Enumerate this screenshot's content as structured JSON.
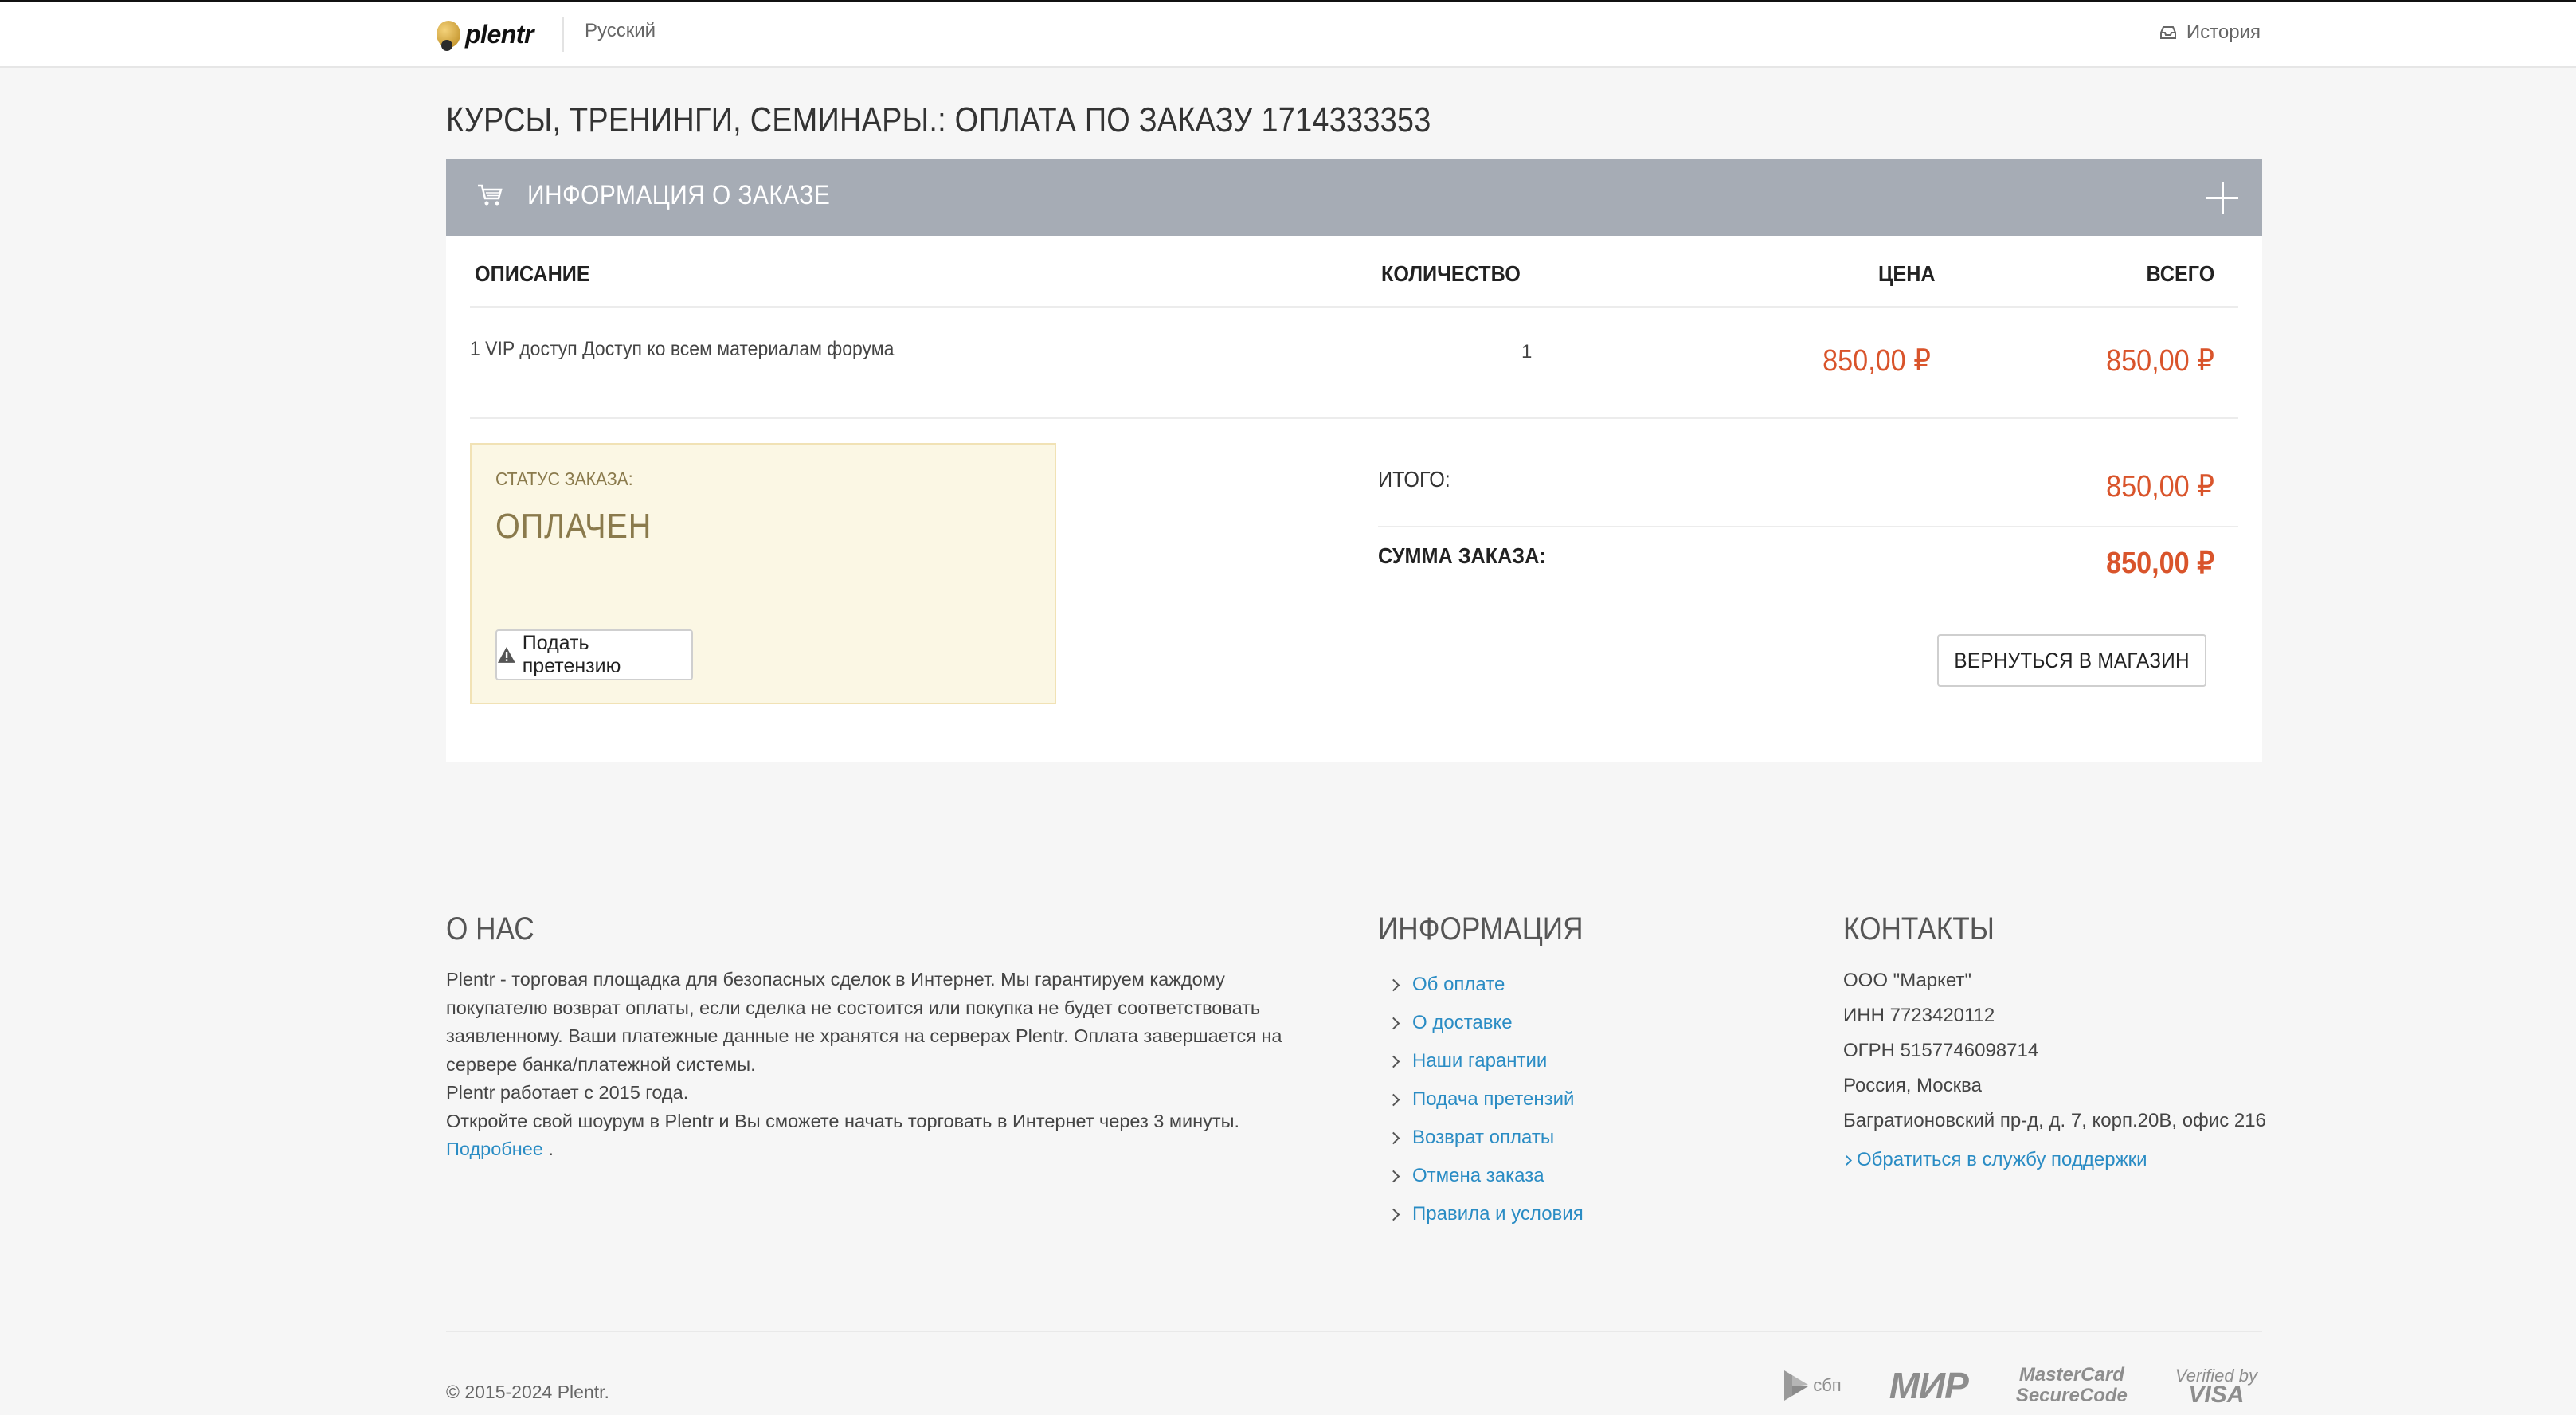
{
  "header": {
    "logo_text": "plentr",
    "language": "Русский",
    "history_label": "История"
  },
  "page_title": "КУРСЫ, ТРЕНИНГИ, СЕМИНАРЫ.: ОПЛАТА ПО ЗАКАЗУ 1714333353",
  "order_panel": {
    "title": "ИНФОРМАЦИЯ О ЗАКАЗЕ",
    "columns": {
      "description": "ОПИСАНИЕ",
      "quantity": "КОЛИЧЕСТВО",
      "price": "ЦЕНА",
      "total": "ВСЕГО"
    },
    "items": [
      {
        "description": "1 VIP доступ Доступ ко всем материалам форума",
        "quantity": "1",
        "price": "850,00 ₽",
        "total": "850,00 ₽"
      }
    ],
    "status": {
      "label": "СТАТУС ЗАКАЗА:",
      "value": "ОПЛАЧЕН",
      "claim_button": "Подать претензию"
    },
    "summary": {
      "subtotal_label": "ИТОГО:",
      "subtotal_value": "850,00 ₽",
      "order_sum_label": "СУММА ЗАКАЗА:",
      "order_sum_value": "850,00 ₽"
    },
    "back_button": "ВЕРНУТЬСЯ В МАГАЗИН"
  },
  "footer": {
    "about": {
      "title": "О НАС",
      "paragraphs": [
        "Plentr - торговая площадка для безопасных сделок в Интернет. Мы гарантируем каждому покупателю возврат оплаты, если сделка не состоится или покупка не будет соответствовать заявленному. Ваши платежные данные не хранятся на серверах Plentr. Оплата завершается на сервере банка/платежной системы.",
        "Plentr работает с 2015 года.",
        "Откройте свой шоурум в Plentr и Вы сможете начать торговать в Интернет через 3 минуты."
      ],
      "more_link": "Подробнее",
      "more_suffix": " ."
    },
    "info": {
      "title": "ИНФОРМАЦИЯ",
      "links": [
        "Об оплате",
        "О доставке",
        "Наши гарантии",
        "Подача претензий",
        "Возврат оплаты",
        "Отмена заказа",
        "Правила и условия"
      ]
    },
    "contacts": {
      "title": "КОНТАКТЫ",
      "company": "ООО \"Маркет\"",
      "inn": "ИНН 7723420112",
      "ogrn": "ОГРН 5157746098714",
      "city": "Россия, Москва",
      "address": "Багратионовский пр-д, д. 7, корп.20В, офис 216",
      "support_link": "Обратиться в службу поддержки"
    },
    "copyright": "© 2015-2024 Plentr.",
    "payment_logos": {
      "sbp": "сбп",
      "mir": "МИР",
      "mastercard_line1": "MasterCard",
      "mastercard_line2": "SecureCode",
      "visa_line1": "Verified by",
      "visa_line2": "VISA"
    }
  },
  "colors": {
    "accent_price": "#d9542b",
    "link": "#2a8cc4",
    "panel_header": "#a6acb5",
    "status_bg": "#fbf7e4"
  }
}
